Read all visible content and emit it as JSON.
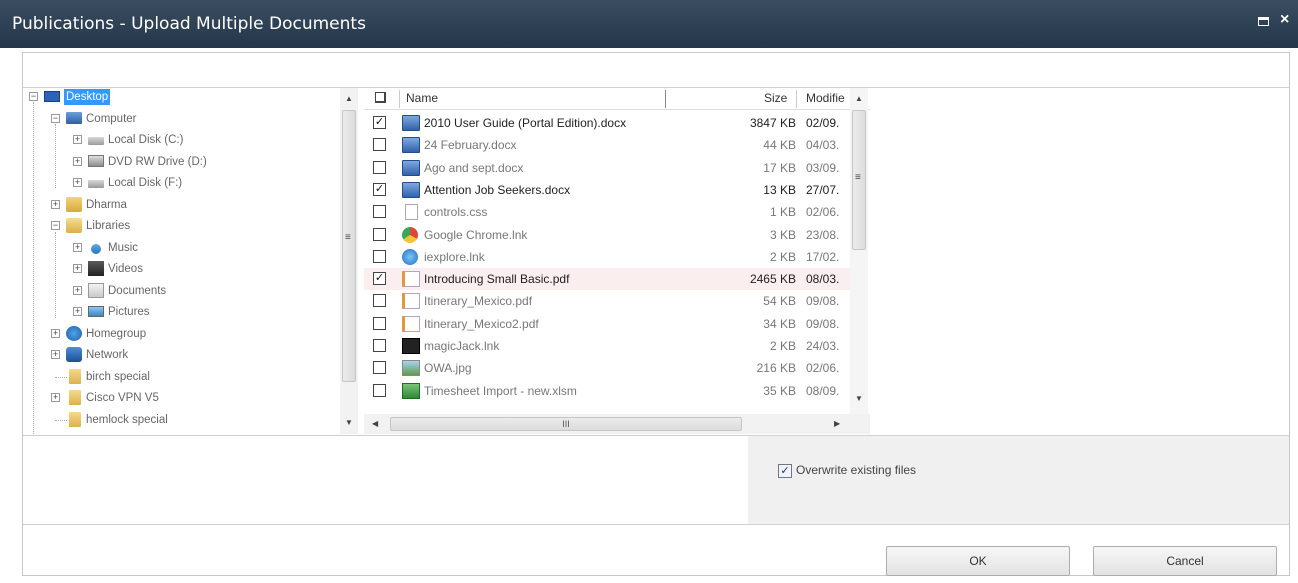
{
  "window": {
    "title": "Publications - Upload Multiple Documents"
  },
  "tree": {
    "items": [
      {
        "label": "Desktop",
        "icon": "desktop-icon"
      },
      {
        "label": "Computer",
        "icon": "computer-icon"
      },
      {
        "label": "Local Disk (C:)",
        "icon": "drive-icon"
      },
      {
        "label": "DVD RW Drive (D:)",
        "icon": "dvd-drive-icon"
      },
      {
        "label": "Local Disk (F:)",
        "icon": "drive-icon"
      },
      {
        "label": "Dharma",
        "icon": "user-folder-icon"
      },
      {
        "label": "Libraries",
        "icon": "libraries-icon"
      },
      {
        "label": "Music",
        "icon": "music-icon"
      },
      {
        "label": "Videos",
        "icon": "videos-icon"
      },
      {
        "label": "Documents",
        "icon": "documents-icon"
      },
      {
        "label": "Pictures",
        "icon": "pictures-icon"
      },
      {
        "label": "Homegroup",
        "icon": "homegroup-icon"
      },
      {
        "label": "Network",
        "icon": "network-icon"
      },
      {
        "label": "birch special",
        "icon": "folder-icon"
      },
      {
        "label": "Cisco VPN V5",
        "icon": "folder-icon"
      },
      {
        "label": "hemlock special",
        "icon": "folder-icon"
      }
    ]
  },
  "filelist": {
    "columns": {
      "name": "Name",
      "size": "Size",
      "modified": "Modifie"
    },
    "rows": [
      {
        "name": "2010 User Guide (Portal Edition).docx",
        "size": "3847 KB",
        "date": "02/09.",
        "checked": true,
        "icon": "word-doc-icon"
      },
      {
        "name": "24 February.docx",
        "size": "44 KB",
        "date": "04/03.",
        "checked": false,
        "icon": "word-doc-icon"
      },
      {
        "name": "Ago and sept.docx",
        "size": "17 KB",
        "date": "03/09.",
        "checked": false,
        "icon": "word-doc-icon"
      },
      {
        "name": "Attention Job Seekers.docx",
        "size": "13 KB",
        "date": "27/07.",
        "checked": true,
        "icon": "word-doc-icon"
      },
      {
        "name": "controls.css",
        "size": "1 KB",
        "date": "02/06.",
        "checked": false,
        "icon": "blank-file-icon"
      },
      {
        "name": "Google Chrome.lnk",
        "size": "3 KB",
        "date": "23/08.",
        "checked": false,
        "icon": "chrome-icon"
      },
      {
        "name": "iexplore.lnk",
        "size": "2 KB",
        "date": "17/02.",
        "checked": false,
        "icon": "ie-icon"
      },
      {
        "name": "Introducing Small Basic.pdf",
        "size": "2465 KB",
        "date": "08/03.",
        "checked": true,
        "icon": "pdf-icon"
      },
      {
        "name": "Itinerary_Mexico.pdf",
        "size": "54 KB",
        "date": "09/08.",
        "checked": false,
        "icon": "pdf-icon"
      },
      {
        "name": "Itinerary_Mexico2.pdf",
        "size": "34 KB",
        "date": "09/08.",
        "checked": false,
        "icon": "pdf-icon"
      },
      {
        "name": "magicJack.lnk",
        "size": "2 KB",
        "date": "24/03.",
        "checked": false,
        "icon": "magicjack-icon"
      },
      {
        "name": "OWA.jpg",
        "size": "216 KB",
        "date": "02/06.",
        "checked": false,
        "icon": "image-icon"
      },
      {
        "name": "Timesheet Import - new.xlsm",
        "size": "35 KB",
        "date": "08/09.",
        "checked": false,
        "icon": "excel-icon"
      }
    ],
    "hscroll_label": "III"
  },
  "options": {
    "overwrite_label": "Overwrite existing files",
    "overwrite_checked": true
  },
  "buttons": {
    "ok": "OK",
    "cancel": "Cancel"
  }
}
